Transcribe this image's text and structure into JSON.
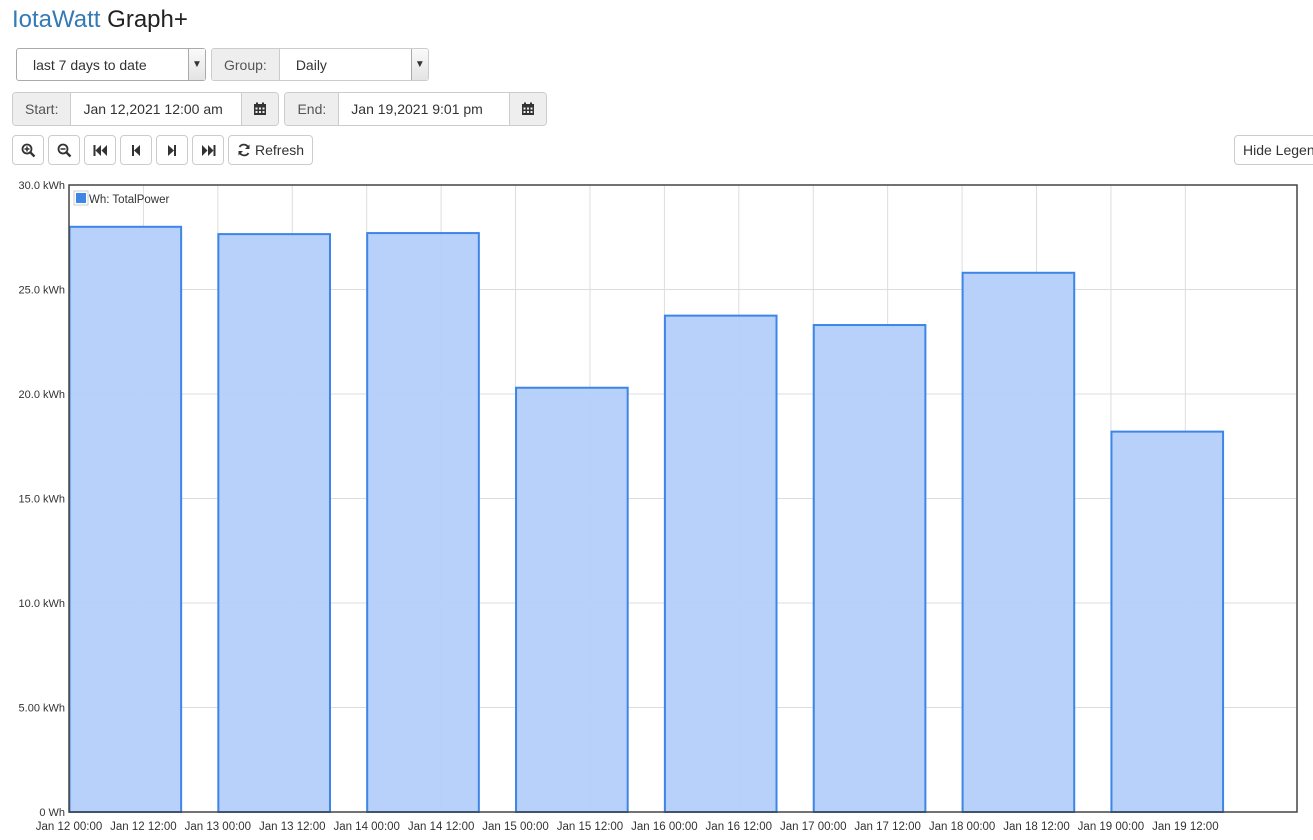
{
  "header": {
    "brand": "IotaWatt",
    "title": "Graph+"
  },
  "controls": {
    "range_value": "last 7 days to date",
    "group_label": "Group:",
    "group_value": "Daily",
    "start_label": "Start:",
    "start_value": "Jan 12,2021 12:00 am",
    "end_label": "End:",
    "end_value": "Jan 19,2021 9:01 pm",
    "refresh_label": "Refresh",
    "hide_legend_label": "Hide Legend"
  },
  "icons": {
    "zoom_in": "zoom-in-icon",
    "zoom_out": "zoom-out-icon",
    "first": "fast-backward-icon",
    "prev": "step-backward-icon",
    "next": "step-forward-icon",
    "last": "fast-forward-icon",
    "refresh": "refresh-icon",
    "calendar": "calendar-icon"
  },
  "chart_data": {
    "type": "bar",
    "categories": [
      "Jan 12",
      "Jan 13",
      "Jan 14",
      "Jan 15",
      "Jan 16",
      "Jan 17",
      "Jan 18",
      "Jan 19"
    ],
    "series": [
      {
        "name": "Wh: TotalPower",
        "values": [
          28.0,
          27.65,
          27.7,
          20.3,
          23.75,
          23.3,
          25.8,
          18.2
        ],
        "color": "#3d85e6",
        "fill": "#b3cffa"
      }
    ],
    "unit": "kWh",
    "ylim": [
      0,
      30
    ],
    "y_ticks": [
      {
        "value": 0,
        "label": "0 Wh"
      },
      {
        "value": 5,
        "label": "5.00 kWh"
      },
      {
        "value": 10,
        "label": "10.0 kWh"
      },
      {
        "value": 15,
        "label": "15.0 kWh"
      },
      {
        "value": 20,
        "label": "20.0 kWh"
      },
      {
        "value": 25,
        "label": "25.0 kWh"
      },
      {
        "value": 30,
        "label": "30.0 kWh"
      }
    ],
    "x_ticks": [
      "Jan 12 00:00",
      "Jan 12 12:00",
      "Jan 13 00:00",
      "Jan 13 12:00",
      "Jan 14 00:00",
      "Jan 14 12:00",
      "Jan 15 00:00",
      "Jan 15 12:00",
      "Jan 16 00:00",
      "Jan 16 12:00",
      "Jan 17 00:00",
      "Jan 17 12:00",
      "Jan 18 00:00",
      "Jan 18 12:00",
      "Jan 19 00:00",
      "Jan 19 12:00"
    ],
    "grid": true,
    "legend": "top-left"
  }
}
